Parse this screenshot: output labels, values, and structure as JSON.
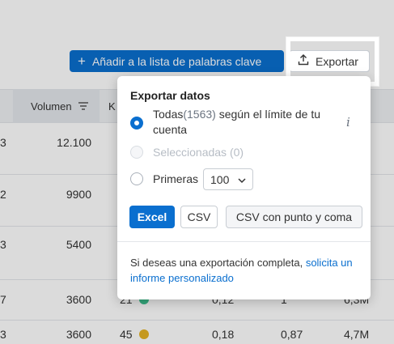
{
  "toolbar": {
    "add_button_label": "Añadir a la lista de palabras clave",
    "export_button_label": "Exportar"
  },
  "table": {
    "columns": {
      "volume": "Volumen",
      "kd": "K"
    },
    "rows": [
      {
        "left": "3",
        "volume": "12.100",
        "kd": "",
        "cpc": "",
        "com": "",
        "results": ""
      },
      {
        "left": "2",
        "volume": "9900",
        "kd": "",
        "cpc": "",
        "com": "",
        "results": ""
      },
      {
        "left": "3",
        "volume": "5400",
        "kd": "",
        "cpc": "",
        "com": "",
        "results": ""
      },
      {
        "left": "7",
        "volume": "3600",
        "kd": "21",
        "cpc": "0,12",
        "com": "1",
        "results": "6,3M"
      },
      {
        "left": "3",
        "volume": "3600",
        "kd": "45",
        "cpc": "0,18",
        "com": "0,87",
        "results": "4,7M"
      }
    ],
    "dot_colors": [
      "#3cc08f",
      "#e6b325"
    ]
  },
  "export_panel": {
    "title": "Exportar datos",
    "option_all": {
      "label": "Todas",
      "count": "(1563)",
      "suffix": " según el límite de tu cuenta"
    },
    "option_selected": "Seleccionadas (0)",
    "option_first": "Primeras",
    "first_count": "100",
    "info_icon": "i",
    "format_buttons": {
      "excel": "Excel",
      "csv": "CSV",
      "csv_semicolon": "CSV con punto y coma"
    },
    "footer_text": "Si deseas una exportación completa, ",
    "footer_link": "solicita un informe personalizado"
  },
  "colors": {
    "accent": "#0a6fcf"
  }
}
